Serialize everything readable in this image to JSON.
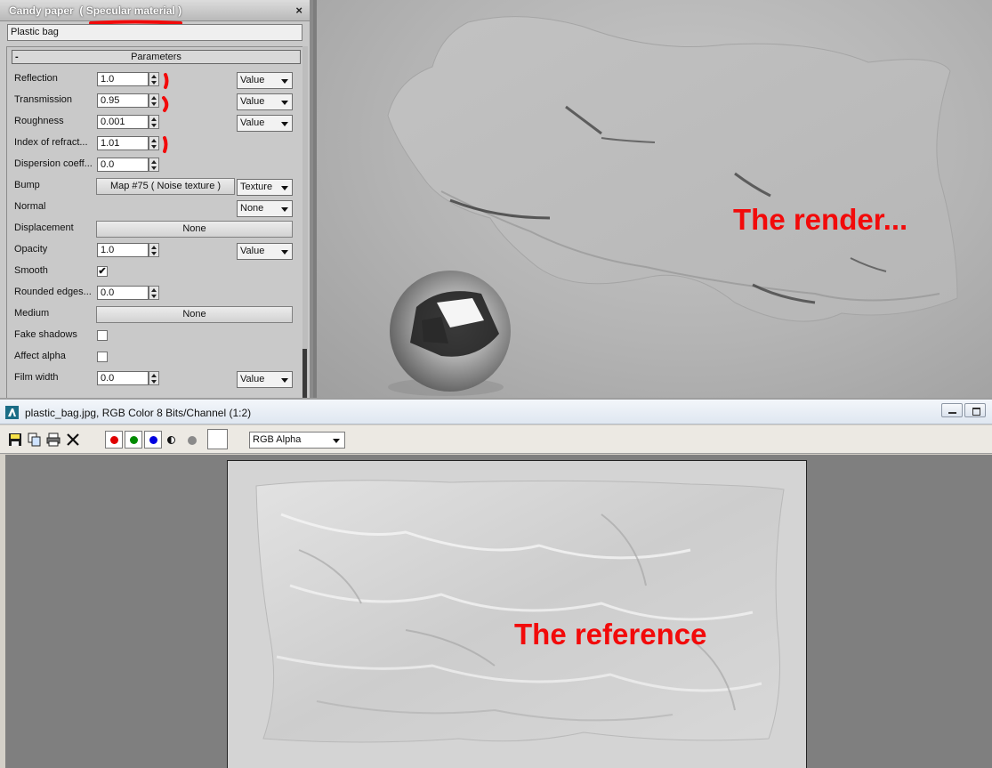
{
  "material_editor": {
    "title": "Candy paper",
    "subtitle": "( Specular material )",
    "name_value": "Plastic bag",
    "rollout_title": "Parameters",
    "rollout_toggle": "-",
    "params": [
      {
        "label": "Reflection",
        "value": "1.0",
        "mode": "Value"
      },
      {
        "label": "Transmission",
        "value": "0.95",
        "mode": "Value"
      },
      {
        "label": "Roughness",
        "value": "0.001",
        "mode": "Value"
      },
      {
        "label": "Index of refract...",
        "value": "1.01"
      },
      {
        "label": "Dispersion coeff...",
        "value": "0.0"
      },
      {
        "label": "Bump",
        "map": "Map #75  ( Noise texture )",
        "mode": "Texture"
      },
      {
        "label": "Normal",
        "mode": "None"
      },
      {
        "label": "Displacement",
        "button": "None"
      },
      {
        "label": "Opacity",
        "value": "1.0",
        "mode": "Value"
      },
      {
        "label": "Smooth",
        "checked": "✔"
      },
      {
        "label": "Rounded edges...",
        "value": "0.0"
      },
      {
        "label": "Medium",
        "button": "None"
      },
      {
        "label": "Fake shadows",
        "checked": ""
      },
      {
        "label": "Affect alpha",
        "checked": ""
      },
      {
        "label": "Film width",
        "value": "0.0",
        "mode": "Value"
      }
    ],
    "close_glyph": "×"
  },
  "viewport": {
    "annotation": "The render..."
  },
  "frame_buffer": {
    "title": "plastic_bag.jpg, RGB Color 8 Bits/Channel (1:2)",
    "channel": "RGB Alpha",
    "annotation": "The reference",
    "toolbar_icons": [
      "save-icon",
      "copy-icon",
      "print-icon",
      "clear-icon"
    ],
    "channel_colors": {
      "red": "#e00000",
      "green": "#008a00",
      "blue": "#0000e0"
    }
  },
  "colors": {
    "annotation_red": "#f20a0a",
    "panel_bg": "#c9c9c9"
  }
}
